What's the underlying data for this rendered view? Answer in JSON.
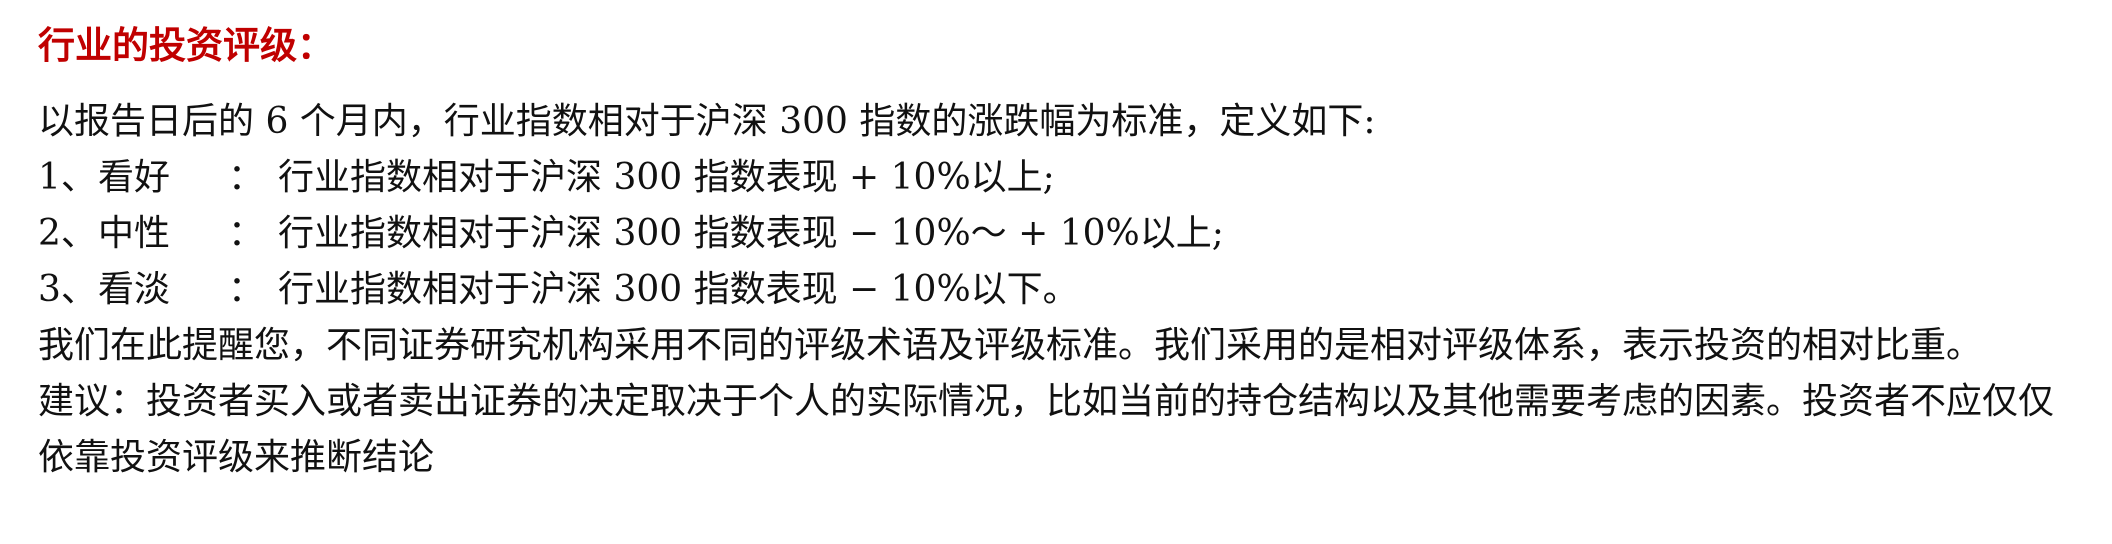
{
  "heading": "行业的投资评级：",
  "intro": "以报告日后的 6 个月内，行业指数相对于沪深 300 指数的涨跌幅为标准，定义如下:",
  "ratings": [
    {
      "num": "1、",
      "name": "看好",
      "colon": "：",
      "desc": "行业指数相对于沪深 300 指数表现 + 10%以上;"
    },
    {
      "num": "2、",
      "name": "中性",
      "colon": "：",
      "desc": "行业指数相对于沪深 300 指数表现 − 10%～ + 10%以上;"
    },
    {
      "num": "3、",
      "name": "看淡",
      "colon": "：",
      "desc": "行业指数相对于沪深 300 指数表现 − 10%以下。"
    }
  ],
  "reminder": "我们在此提醒您，不同证券研究机构采用不同的评级术语及评级标准。我们采用的是相对评级体系，表示投资的相对比重。",
  "suggestion": "建议：投资者买入或者卖出证券的决定取决于个人的实际情况，比如当前的持仓结构以及其他需要考虑的因素。投资者不应仅仅依靠投资评级来推断结论"
}
